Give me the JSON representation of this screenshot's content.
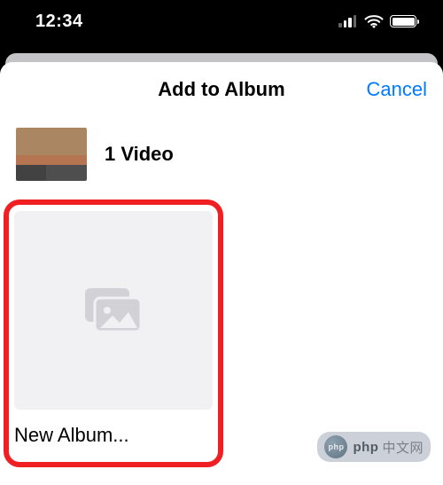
{
  "statusbar": {
    "time": "12:34"
  },
  "sheet": {
    "title": "Add to Album",
    "cancel_label": "Cancel",
    "selection_label": "1 Video"
  },
  "albums": {
    "new_album_label": "New Album..."
  },
  "watermark": {
    "brand_bold": "php",
    "brand_rest": "中文网"
  }
}
